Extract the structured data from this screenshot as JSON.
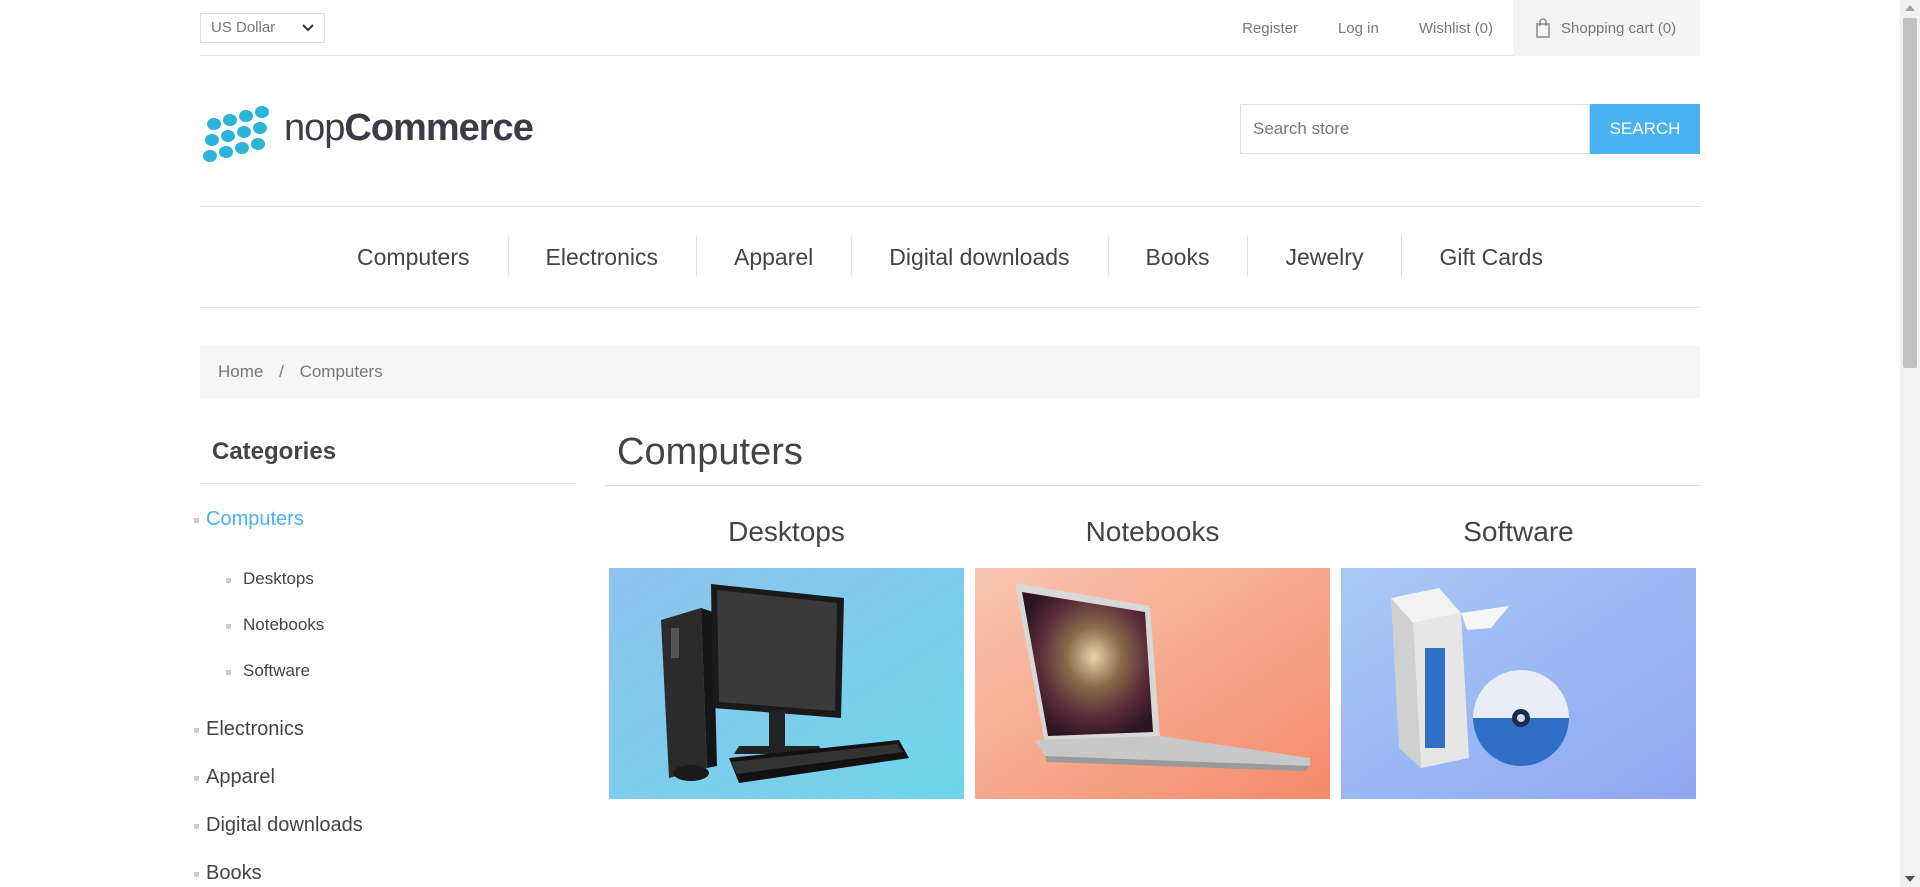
{
  "header": {
    "currency": "US Dollar",
    "register": "Register",
    "login": "Log in",
    "wishlist": "Wishlist (0)",
    "cart": "Shopping cart (0)"
  },
  "logo": {
    "prefix": "nop",
    "name": "Commerce"
  },
  "search": {
    "placeholder": "Search store",
    "button": "SEARCH"
  },
  "menu": [
    "Computers",
    "Electronics",
    "Apparel",
    "Digital downloads",
    "Books",
    "Jewelry",
    "Gift Cards"
  ],
  "breadcrumb": {
    "home": "Home",
    "separator": "/",
    "current": "Computers"
  },
  "sidebar": {
    "title": "Categories",
    "categories": [
      "Computers",
      "Electronics",
      "Apparel",
      "Digital downloads",
      "Books"
    ],
    "subcategories": [
      "Desktops",
      "Notebooks",
      "Software"
    ]
  },
  "main": {
    "title": "Computers",
    "subcategories": [
      {
        "name": "Desktops",
        "icon": "desktop-computer-image"
      },
      {
        "name": "Notebooks",
        "icon": "notebook-image"
      },
      {
        "name": "Software",
        "icon": "software-box-image"
      }
    ]
  },
  "colors": {
    "accent": "#4ab2f1",
    "logo": "#29b4d8"
  }
}
